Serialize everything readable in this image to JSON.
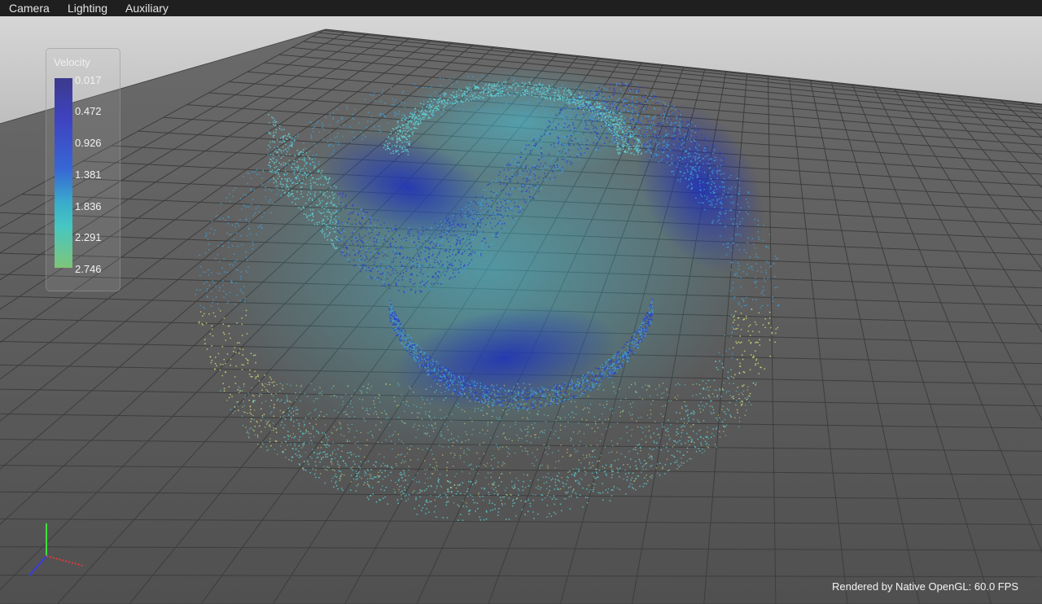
{
  "menu": {
    "camera": "Camera",
    "lighting": "Lighting",
    "auxiliary": "Auxiliary"
  },
  "legend": {
    "title": "Velocity",
    "ticks": [
      "0.017",
      "0.472",
      "0.926",
      "1.381",
      "1.836",
      "2.291",
      "2.746"
    ],
    "colors": [
      "#3c3a8e",
      "#3f43c0",
      "#3767d5",
      "#3aaccc",
      "#46c7c2",
      "#7ec579"
    ]
  },
  "status": {
    "render_info": "Rendered by Native OpenGL: 60.0 FPS"
  },
  "scene": {
    "background_top": "#d8d8d8",
    "floor_color": "#5f5f5f",
    "grid_line_color": "#3a3a3a",
    "particle_colors": {
      "slow": "#2a3fc9",
      "medium": "#3da2da",
      "fast": "#5fd3d6",
      "fastest": "#d8e07a"
    },
    "axis_colors": {
      "x": "#e23b3b",
      "y": "#3fe03f",
      "z": "#3b3be2"
    }
  }
}
